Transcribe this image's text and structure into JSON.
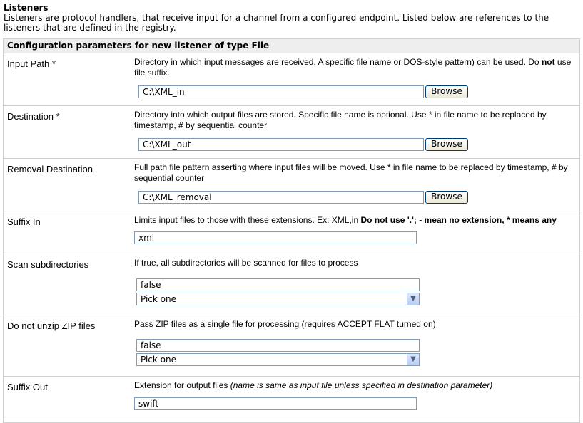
{
  "page": {
    "heading": "Listeners",
    "intro": "Listeners are protocol handlers, that receive input for a channel from a configured endpoint. Listed below are references to the listeners that are defined in the registry."
  },
  "panel": {
    "title": "Configuration parameters for new listener of type File"
  },
  "rows": {
    "input_path": {
      "label": "Input Path *",
      "desc_a": "Directory in which input messages are received. A specific file name or DOS-style pattern) can be used. Do ",
      "desc_b": "not",
      "desc_c": " use file suffix.",
      "value": "C:\\XML_in",
      "button": "Browse"
    },
    "destination": {
      "label": "Destination *",
      "desc": "Directory into which output files are stored. Specific file name is optional. Use * in file name to be replaced by timestamp, # by sequential counter",
      "value": "C:\\XML_out",
      "button": "Browse"
    },
    "removal_destination": {
      "label": "Removal Destination",
      "desc": "Full path file pattern asserting where input files will be moved. Use * in file name to be replaced by timestamp, # by sequential counter",
      "value": "C:\\XML_removal",
      "button": "Browse"
    },
    "suffix_in": {
      "label": "Suffix In",
      "desc_a": "Limits input files to those with these extensions. Ex: XML,in ",
      "desc_b": "Do not use '.'; - mean no extension, * means any",
      "value": "xml"
    },
    "scan_subdirectories": {
      "label": "Scan subdirectories",
      "desc": "If true, all subdirectories will be scanned for files to process",
      "value": "false",
      "select": "Pick one"
    },
    "do_not_unzip": {
      "label": "Do not unzip ZIP files",
      "desc": "Pass ZIP files as a single file for processing (requires ACCEPT FLAT turned on)",
      "value": "false",
      "select": "Pick one"
    },
    "suffix_out": {
      "label": "Suffix Out",
      "desc_a": "Extension for output files ",
      "desc_b": "(name is same as input file unless specified in destination parameter)",
      "value": "swift"
    }
  },
  "icons": {
    "dropdown": "chevron-down-icon"
  }
}
